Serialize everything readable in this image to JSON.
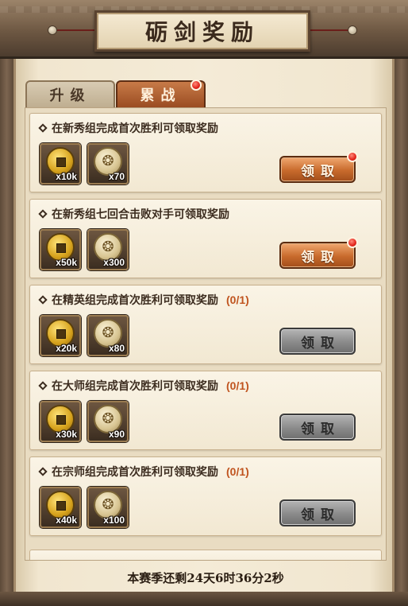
{
  "header": {
    "title": "砺剑奖励"
  },
  "tabs": [
    {
      "label": "升级",
      "active": false,
      "badge": false
    },
    {
      "label": "累战",
      "active": true,
      "badge": true
    }
  ],
  "tasks": [
    {
      "title": "在新秀组完成首次胜利可领取奖励",
      "progress": "",
      "rewards": [
        {
          "icon": "copper-coin-icon",
          "qty": "x10k"
        },
        {
          "icon": "medal-icon",
          "qty": "x70"
        }
      ],
      "button": {
        "label": "领取",
        "state": "active",
        "badge": true
      }
    },
    {
      "title": "在新秀组七回合击败对手可领取奖励",
      "progress": "",
      "rewards": [
        {
          "icon": "copper-coin-icon",
          "qty": "x50k"
        },
        {
          "icon": "medal-icon",
          "qty": "x300"
        }
      ],
      "button": {
        "label": "领取",
        "state": "active",
        "badge": true
      }
    },
    {
      "title": "在精英组完成首次胜利可领取奖励",
      "progress": "(0/1)",
      "rewards": [
        {
          "icon": "copper-coin-icon",
          "qty": "x20k"
        },
        {
          "icon": "medal-icon",
          "qty": "x80"
        }
      ],
      "button": {
        "label": "领取",
        "state": "disabled",
        "badge": false
      }
    },
    {
      "title": "在大师组完成首次胜利可领取奖励",
      "progress": "(0/1)",
      "rewards": [
        {
          "icon": "copper-coin-icon",
          "qty": "x30k"
        },
        {
          "icon": "medal-icon",
          "qty": "x90"
        }
      ],
      "button": {
        "label": "领取",
        "state": "disabled",
        "badge": false
      }
    },
    {
      "title": "在宗师组完成首次胜利可领取奖励",
      "progress": "(0/1)",
      "rewards": [
        {
          "icon": "copper-coin-icon",
          "qty": "x40k"
        },
        {
          "icon": "medal-icon",
          "qty": "x100"
        }
      ],
      "button": {
        "label": "领取",
        "state": "disabled",
        "badge": false
      }
    }
  ],
  "footer": {
    "season_remaining": "本赛季还剩24天6时36分2秒"
  },
  "colors": {
    "active_button": "#c86a2c",
    "disabled_button": "#8a8a8a",
    "progress_text": "#c0541f",
    "badge": "#e2231a"
  }
}
